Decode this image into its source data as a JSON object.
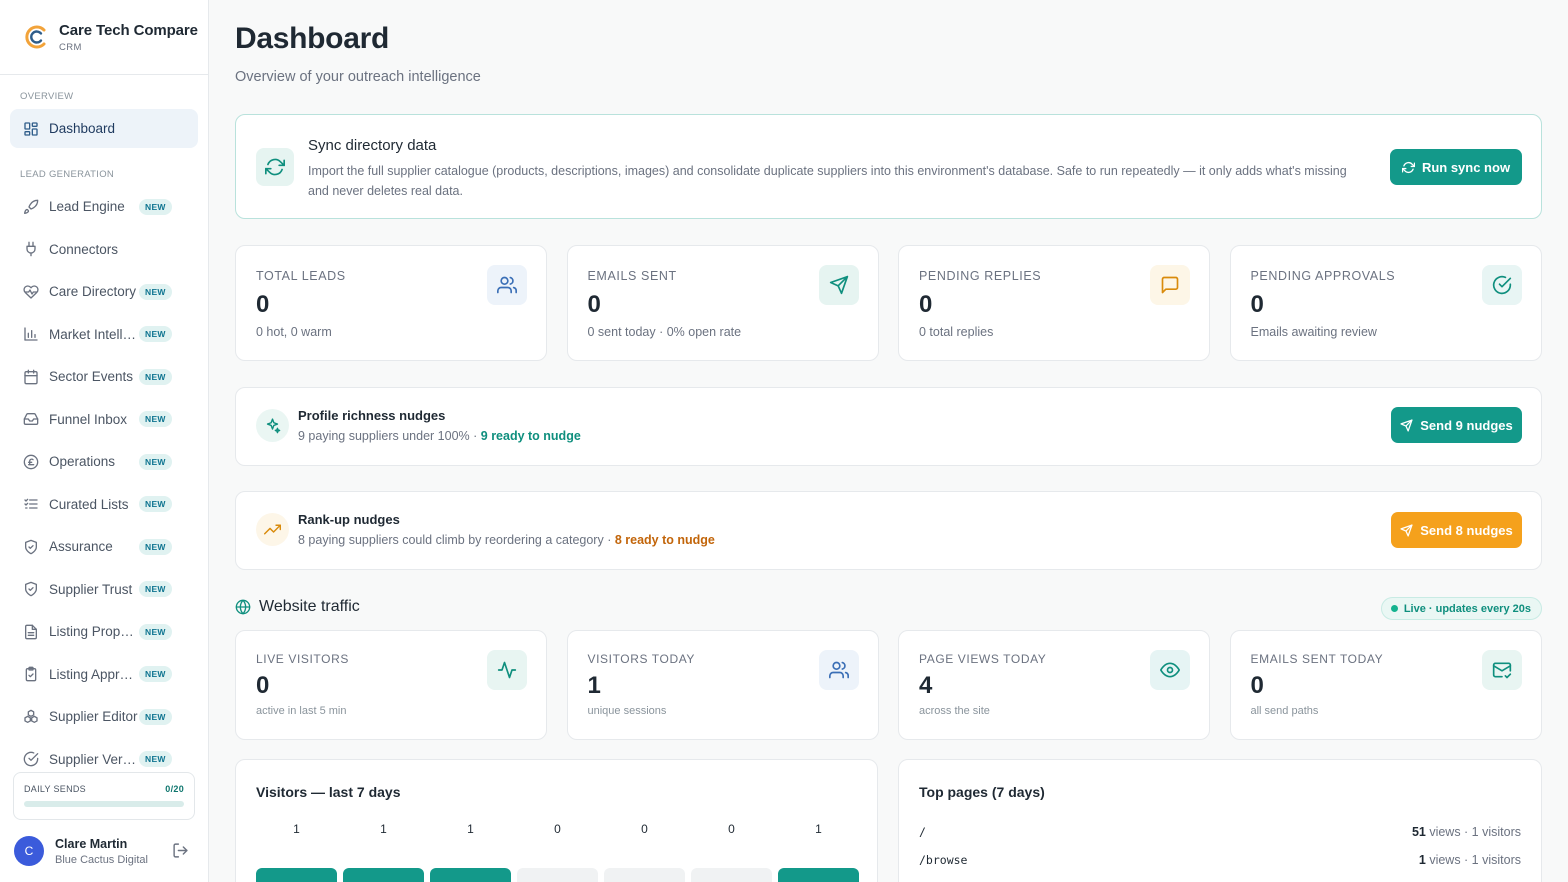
{
  "brand": {
    "name": "Care Tech Compare",
    "sub": "CRM"
  },
  "nav": {
    "section_overview": "OVERVIEW",
    "section_leadgen": "LEAD GENERATION",
    "items": [
      {
        "label": "Dashboard",
        "icon": "dashboard-icon",
        "badge": ""
      },
      {
        "label": "Lead Engine",
        "icon": "rocket-icon",
        "badge": "NEW"
      },
      {
        "label": "Connectors",
        "icon": "plug-icon",
        "badge": ""
      },
      {
        "label": "Care Directory",
        "icon": "heart-icon",
        "badge": "NEW"
      },
      {
        "label": "Market Intelligence",
        "icon": "bar-chart-icon",
        "badge": "NEW"
      },
      {
        "label": "Sector Events",
        "icon": "calendar-icon",
        "badge": "NEW"
      },
      {
        "label": "Funnel Inbox",
        "icon": "inbox-icon",
        "badge": "NEW"
      },
      {
        "label": "Operations",
        "icon": "pound-icon",
        "badge": "NEW"
      },
      {
        "label": "Curated Lists",
        "icon": "checklist-icon",
        "badge": "NEW"
      },
      {
        "label": "Assurance",
        "icon": "shield-check-icon",
        "badge": "NEW"
      },
      {
        "label": "Supplier Trust",
        "icon": "shield-check-icon",
        "badge": "NEW"
      },
      {
        "label": "Listing Proposals",
        "icon": "document-icon",
        "badge": "NEW"
      },
      {
        "label": "Listing Approvals",
        "icon": "clipboard-check-icon",
        "badge": "NEW"
      },
      {
        "label": "Supplier Editor",
        "icon": "cubes-icon",
        "badge": "NEW"
      },
      {
        "label": "Supplier Verification",
        "icon": "check-circle-icon",
        "badge": "NEW"
      }
    ]
  },
  "daily_sends": {
    "label": "DAILY SENDS",
    "value": "0/20",
    "progress": 0
  },
  "user": {
    "initial": "C",
    "name": "Clare Martin",
    "org": "Blue Cactus Digital"
  },
  "page": {
    "title": "Dashboard",
    "subtitle": "Overview of your outreach intelligence"
  },
  "sync": {
    "title": "Sync directory data",
    "description": "Import the full supplier catalogue (products, descriptions, images) and consolidate duplicate suppliers into this environment's database. Safe to run repeatedly — it only adds what's missing and never deletes real data.",
    "button": "Run sync now"
  },
  "stats": [
    {
      "label": "TOTAL LEADS",
      "value": "0",
      "sub": "0 hot, 0 warm",
      "icon": "users-icon",
      "color": "#3b6fb6",
      "bg": "#edf3fa"
    },
    {
      "label": "EMAILS SENT",
      "value": "0",
      "sub": "0 sent today · 0% open rate",
      "icon": "send-icon",
      "color": "#0f8f7e",
      "bg": "#e6f4f1"
    },
    {
      "label": "PENDING REPLIES",
      "value": "0",
      "sub": "0 total replies",
      "icon": "message-icon",
      "color": "#d98b0c",
      "bg": "#fdf6e7"
    },
    {
      "label": "PENDING APPROVALS",
      "value": "0",
      "sub": "Emails awaiting review",
      "icon": "check-circle-icon",
      "color": "#0f8f7e",
      "bg": "#e8f5f4"
    }
  ],
  "nudges": [
    {
      "title": "Profile richness nudges",
      "desc": "9 paying suppliers under 100% · ",
      "ready": "9 ready to nudge",
      "button": "Send 9 nudges"
    },
    {
      "title": "Rank-up nudges",
      "desc": "8 paying suppliers could climb by reordering a category · ",
      "ready": "8 ready to nudge",
      "button": "Send 8 nudges"
    }
  ],
  "traffic": {
    "title": "Website traffic",
    "live": "Live · updates every 20s",
    "stats": [
      {
        "label": "LIVE VISITORS",
        "value": "0",
        "sub": "active in last 5 min",
        "icon": "activity-icon",
        "color": "#0f8f7e",
        "bg": "#e8f5f2"
      },
      {
        "label": "VISITORS TODAY",
        "value": "1",
        "sub": "unique sessions",
        "icon": "users-icon",
        "color": "#3b6fb6",
        "bg": "#edf3fa"
      },
      {
        "label": "PAGE VIEWS TODAY",
        "value": "4",
        "sub": "across the site",
        "icon": "eye-icon",
        "color": "#0f8f7e",
        "bg": "#e6f4f4"
      },
      {
        "label": "EMAILS SENT TODAY",
        "value": "0",
        "sub": "all send paths",
        "icon": "mail-check-icon",
        "color": "#0f8f7e",
        "bg": "#e8f5f2"
      }
    ]
  },
  "chart_data": {
    "type": "bar",
    "title": "Visitors — last 7 days",
    "categories": [
      "",
      "",
      "",
      "",
      "",
      "",
      ""
    ],
    "values": [
      1,
      1,
      1,
      0,
      0,
      0,
      1
    ],
    "colors": {
      "filled": "#13998a",
      "empty": "#f0f2f3"
    }
  },
  "top_pages": {
    "title": "Top pages (7 days)",
    "rows": [
      {
        "path": "/",
        "views": "51",
        "suffix": " views · 1 visitors"
      },
      {
        "path": "/browse",
        "views": "1",
        "suffix": " views · 1 visitors"
      }
    ]
  }
}
